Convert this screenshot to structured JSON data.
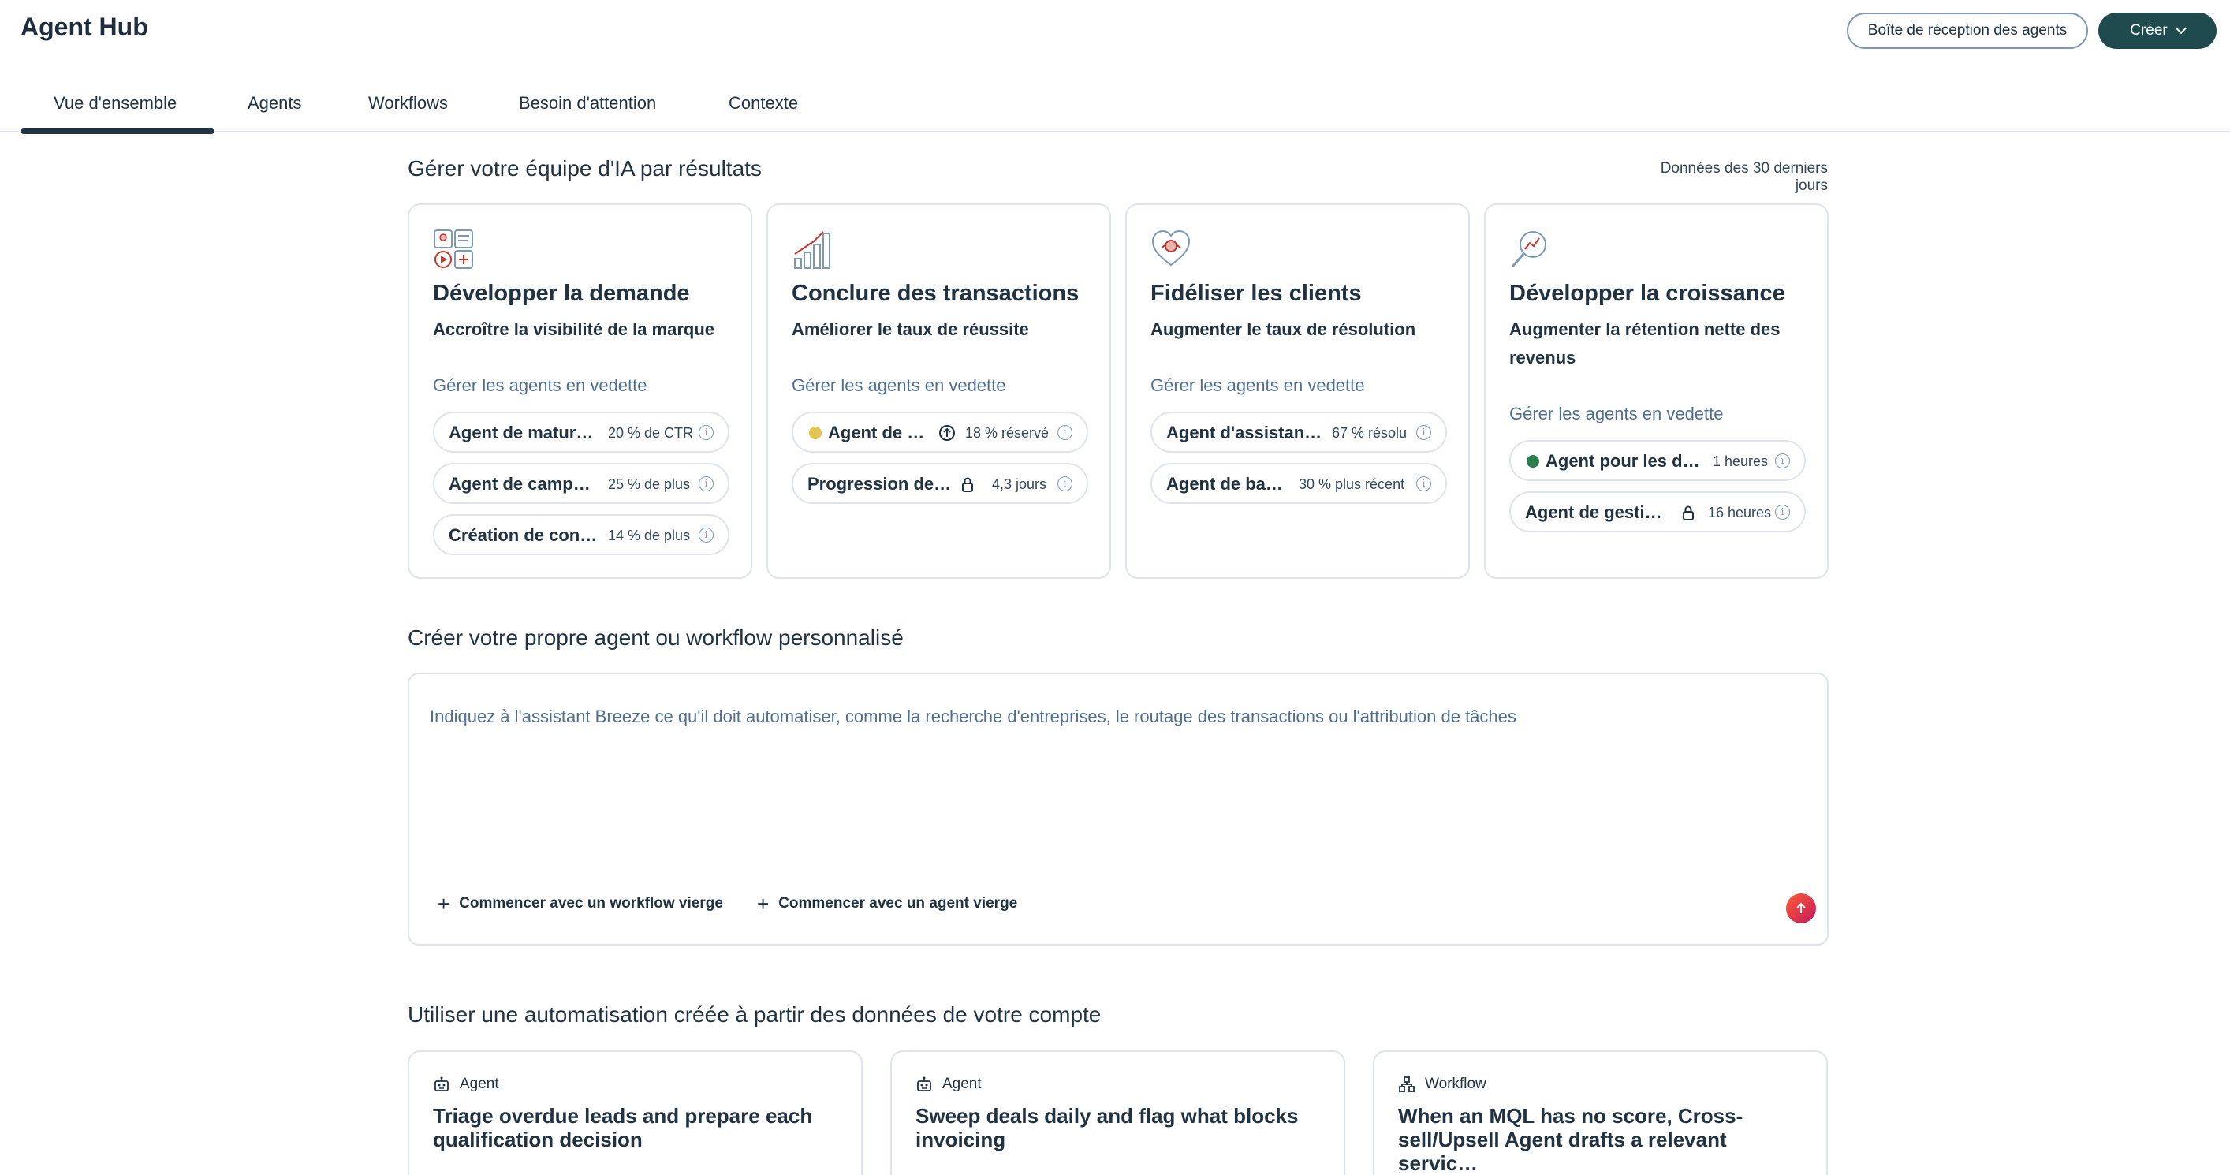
{
  "header": {
    "app_title": "Agent Hub",
    "inbox_button": "Boîte de réception des agents",
    "create_button": "Créer"
  },
  "tabs": [
    {
      "label": "Vue d'ensemble",
      "active": true
    },
    {
      "label": "Agents"
    },
    {
      "label": "Workflows"
    },
    {
      "label": "Besoin d'attention"
    },
    {
      "label": "Contexte"
    }
  ],
  "outcomes": {
    "title": "Gérer votre équipe d'IA par résultats",
    "range_note": "Données des 30 derniers jours",
    "cards": [
      {
        "icon": "demand-generation-icon",
        "title": "Développer la demande",
        "subtitle": "Accroître la visibilité de la marque",
        "manage_label": "Gérer les agents en vedette",
        "agents": [
          {
            "name": "Agent de matura…",
            "metric": "20 % de CTR"
          },
          {
            "name": "Agent de campa…",
            "metric": "25 % de plus"
          },
          {
            "name": "Création de cont…",
            "metric": "14 % de plus"
          }
        ]
      },
      {
        "icon": "bar-growth-icon",
        "title": "Conclure des transactions",
        "subtitle": "Améliorer le taux de réussite",
        "manage_label": "Gérer les agents en vedette",
        "agents": [
          {
            "name": "Agent de p…",
            "metric": "18 % réservé",
            "status_color": "#e5c54f",
            "mini_icon": "arrow-up-circle-icon"
          },
          {
            "name": "Progression des …",
            "metric": "4,3 jours",
            "mini_icon": "lock-icon"
          }
        ]
      },
      {
        "icon": "heart-customer-icon",
        "title": "Fidéliser les clients",
        "subtitle": "Augmenter le taux de résolution",
        "manage_label": "Gérer les agents en vedette",
        "agents": [
          {
            "name": "Agent d'assistanc…",
            "metric": "67 % résolu"
          },
          {
            "name": "Agent de bas…",
            "metric": "30 % plus récent"
          }
        ]
      },
      {
        "icon": "magnifier-growth-icon",
        "title": "Développer la croissance",
        "subtitle": "Augmenter la rétention nette des revenus",
        "manage_label": "Gérer les agents en vedette",
        "agents": [
          {
            "name": "Agent pour les do…",
            "metric": "1 heures",
            "status_color": "#2e7d4f"
          },
          {
            "name": "Agent de gestio…",
            "metric": "16 heures",
            "mini_icon": "lock-icon"
          }
        ]
      }
    ]
  },
  "builder": {
    "title": "Créer votre propre agent ou workflow personnalisé",
    "placeholder": "Indiquez à l'assistant Breeze ce qu'il doit automatiser, comme la recherche d'entreprises, le routage des transactions ou l'attribution de tâches",
    "start_workflow": "Commencer avec un workflow vierge",
    "start_agent": "Commencer avec un agent vierge"
  },
  "suggestions": {
    "title": "Utiliser une automatisation créée à partir des données de votre compte",
    "cards": [
      {
        "kind": "Agent",
        "kind_icon": "robot-icon",
        "title": "Triage overdue leads and prepare each qualification decision"
      },
      {
        "kind": "Agent",
        "kind_icon": "robot-icon",
        "title": "Sweep deals daily and flag what blocks invoicing"
      },
      {
        "kind": "Workflow",
        "kind_icon": "workflow-icon",
        "title": "When an MQL has no score, Cross-sell/Upsell Agent drafts a relevant servic…"
      }
    ]
  }
}
